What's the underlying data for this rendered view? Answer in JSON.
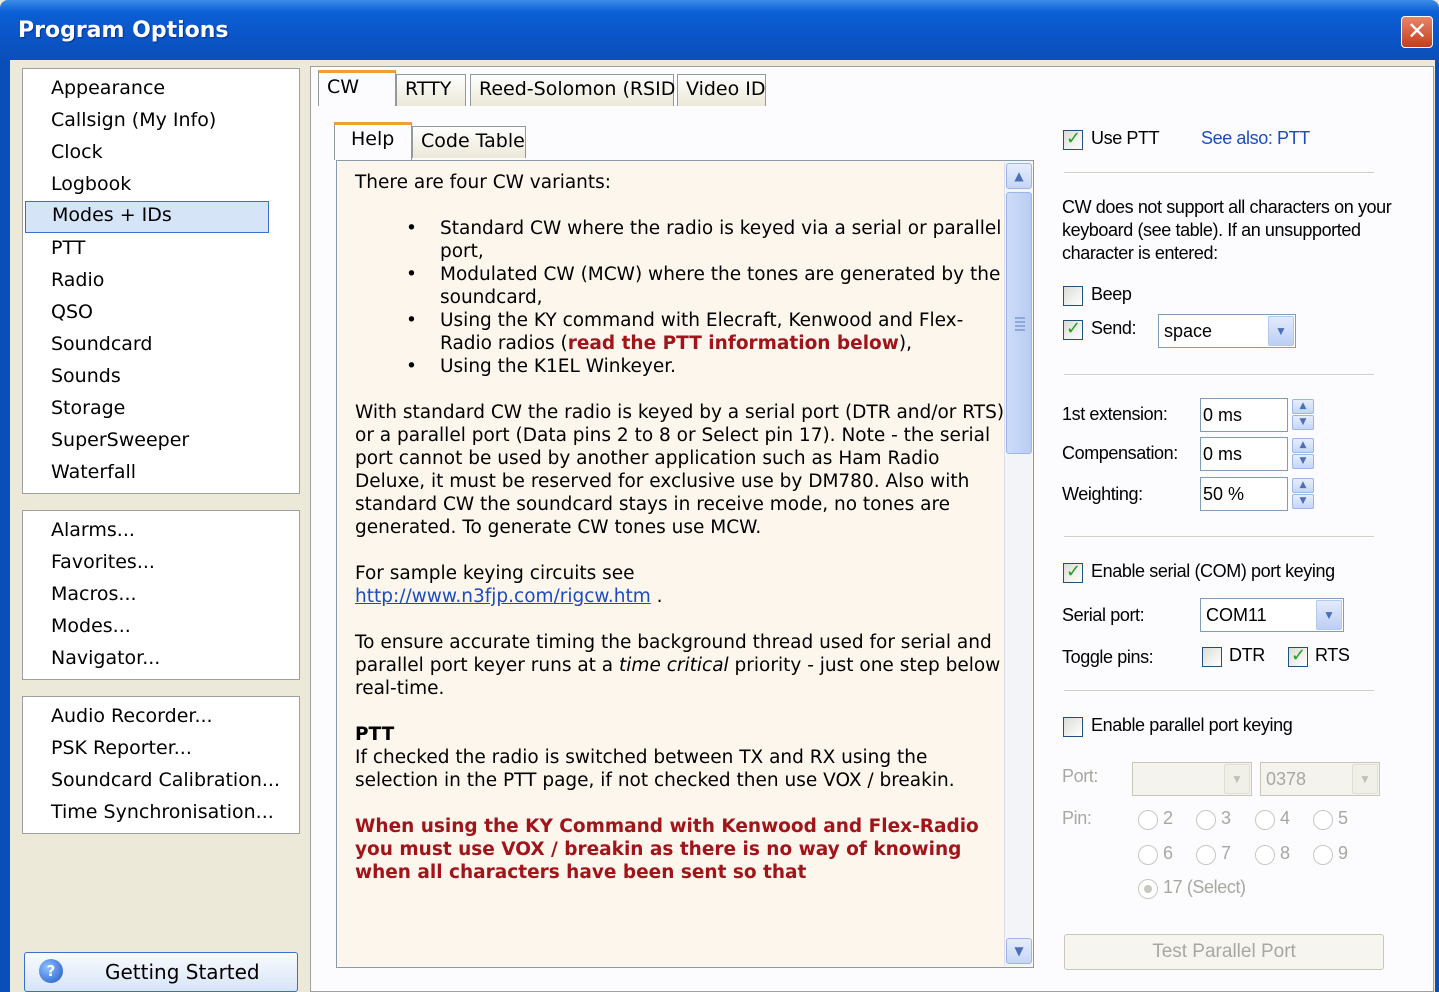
{
  "window": {
    "title": "Program Options",
    "close": "✕"
  },
  "nav_group1": [
    "Appearance",
    "Callsign (My Info)",
    "Clock",
    "Logbook",
    "Modes + IDs",
    "PTT",
    "Radio",
    "QSO",
    "Soundcard",
    "Sounds",
    "Storage",
    "SuperSweeper",
    "Waterfall"
  ],
  "nav_group2": [
    "Alarms...",
    "Favorites...",
    "Macros...",
    "Modes...",
    "Navigator..."
  ],
  "nav_group3": [
    "Audio Recorder...",
    "PSK Reporter...",
    "Soundcard Calibration...",
    "Time Synchronisation..."
  ],
  "getting_started": {
    "label": "Getting Started",
    "icon": "?"
  },
  "tabs": [
    "CW",
    "RTTY",
    "Reed-Solomon (RSID)",
    "Video ID"
  ],
  "subtabs": [
    "Help",
    "Code Table"
  ],
  "help": {
    "intro": "There are four CW variants:",
    "b1": "Standard CW where the radio is keyed via a serial or parallel port,",
    "b2": "Modulated CW (MCW) where the tones are generated by the soundcard,",
    "b3_plain": "Using the KY command with Elecraft, Kenwood and Flex-Radio radios (",
    "b3_red": "read the PTT information below",
    "b3_end": "),",
    "b4": "Using the K1EL Winkeyer.",
    "p1": "With standard CW the radio is keyed by a serial port (DTR and/or RTS) or a parallel port (Data pins 2 to 8 or Select pin 17). Note - the serial port cannot be used by another application such as Ham Radio Deluxe, it must be reserved for exclusive use by DM780. Also with standard CW the soundcard stays in receive mode, no tones are generated. To generate CW tones use MCW.",
    "p2": "For sample keying circuits see",
    "p2_link": "http://www.n3fjp.com/rigcw.htm",
    "p2_end": " .",
    "p3a": "To ensure accurate timing the background thread used for serial and parallel port keyer runs at a ",
    "p3_italic": "time critical",
    "p3b": " priority - just one step below real-time.",
    "ptt_head": "PTT",
    "ptt_body": "If checked the radio is switched between TX and RX using the selection in the PTT page, if not checked then use VOX / breakin.",
    "warning": "When using the KY Command with Kenwood and Flex-Radio you must use VOX / breakin as there is no way of knowing when all characters have been sent so that"
  },
  "right": {
    "use_ptt": "Use PTT",
    "see_also": "See also: PTT",
    "unsupported_text": "CW does not support all characters on your keyboard (see table). If an unsupported character is entered:",
    "beep": "Beep",
    "send": "Send:",
    "send_value": "space",
    "ext_label": "1st extension:",
    "ext_value": "0 ms",
    "comp_label": "Compensation:",
    "comp_value": "0 ms",
    "weight_label": "Weighting:",
    "weight_value": "50 %",
    "serial_keying": "Enable serial (COM) port keying",
    "serial_port_label": "Serial port:",
    "serial_port_value": "COM11",
    "toggle_label": "Toggle pins:",
    "dtr": "DTR",
    "rts": "RTS",
    "parallel_keying": "Enable parallel port keying",
    "port_label": "Port:",
    "port_value": "",
    "port_addr": "0378",
    "pin_label": "Pin:",
    "pins": [
      "2",
      "3",
      "4",
      "5",
      "6",
      "7",
      "8",
      "9"
    ],
    "pin_select": "17 (Select)",
    "test_button": "Test Parallel Port"
  }
}
